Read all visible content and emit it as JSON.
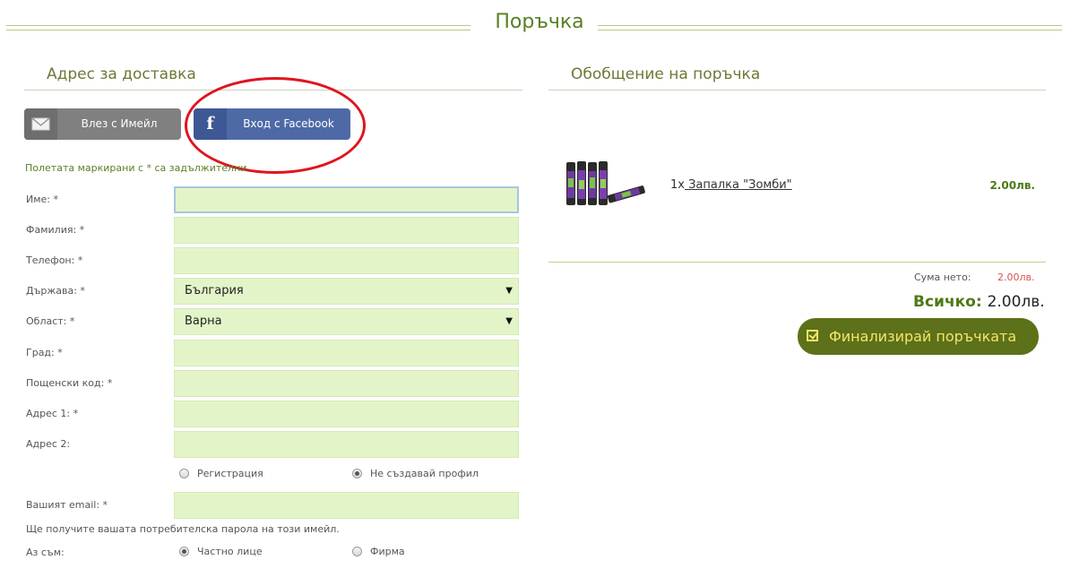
{
  "page": {
    "title": "Поръчка"
  },
  "delivery": {
    "title": "Адрес за доставка",
    "login_email": "Влез с Имейл",
    "login_facebook": "Вход с Facebook",
    "required_note": "Полетата маркирани с * са задължителни",
    "fields": {
      "first_name": {
        "label": "Име: *",
        "value": ""
      },
      "last_name": {
        "label": "Фамилия: *",
        "value": ""
      },
      "phone": {
        "label": "Телефон: *",
        "value": ""
      },
      "country": {
        "label": "Държава: *",
        "value": "България"
      },
      "region": {
        "label": "Област: *",
        "value": "Варна"
      },
      "city": {
        "label": "Град: *",
        "value": ""
      },
      "postcode": {
        "label": "Пощенски код: *",
        "value": ""
      },
      "address1": {
        "label": "Адрес 1: *",
        "value": ""
      },
      "address2": {
        "label": "Адрес 2:",
        "value": ""
      }
    },
    "account_options": {
      "register": "Регистрация",
      "no_profile": "Не създавай профил",
      "selected": "no_profile"
    },
    "email": {
      "label": "Вашият email: *",
      "value": ""
    },
    "password_note": "Ще получите вашата потребителска парола на този имейл.",
    "i_am": {
      "label": "Аз съм:",
      "private": "Частно лице",
      "company": "Фирма",
      "selected": "private"
    }
  },
  "summary": {
    "title": "Обобщение на поръчка",
    "items": [
      {
        "qty": "1x",
        "name": " Запалка \"Зомби\"",
        "price": "2.00лв."
      }
    ],
    "net_label": "Сума нето:",
    "net_value": "2.00лв.",
    "total_label": "Всичко:",
    "total_value": "2.00лв.",
    "finalize_label": "Финализирай поръчката"
  },
  "colors": {
    "accent": "#5a7f22",
    "button": "#5c7119",
    "facebook": "#4e6aa6",
    "annotation": "#e0141e",
    "input_bg": "#e3f5c8"
  },
  "icons": [
    "envelope-icon",
    "facebook-icon",
    "checkbox-icon",
    "dropdown-arrow-icon",
    "lighter-product-image"
  ]
}
